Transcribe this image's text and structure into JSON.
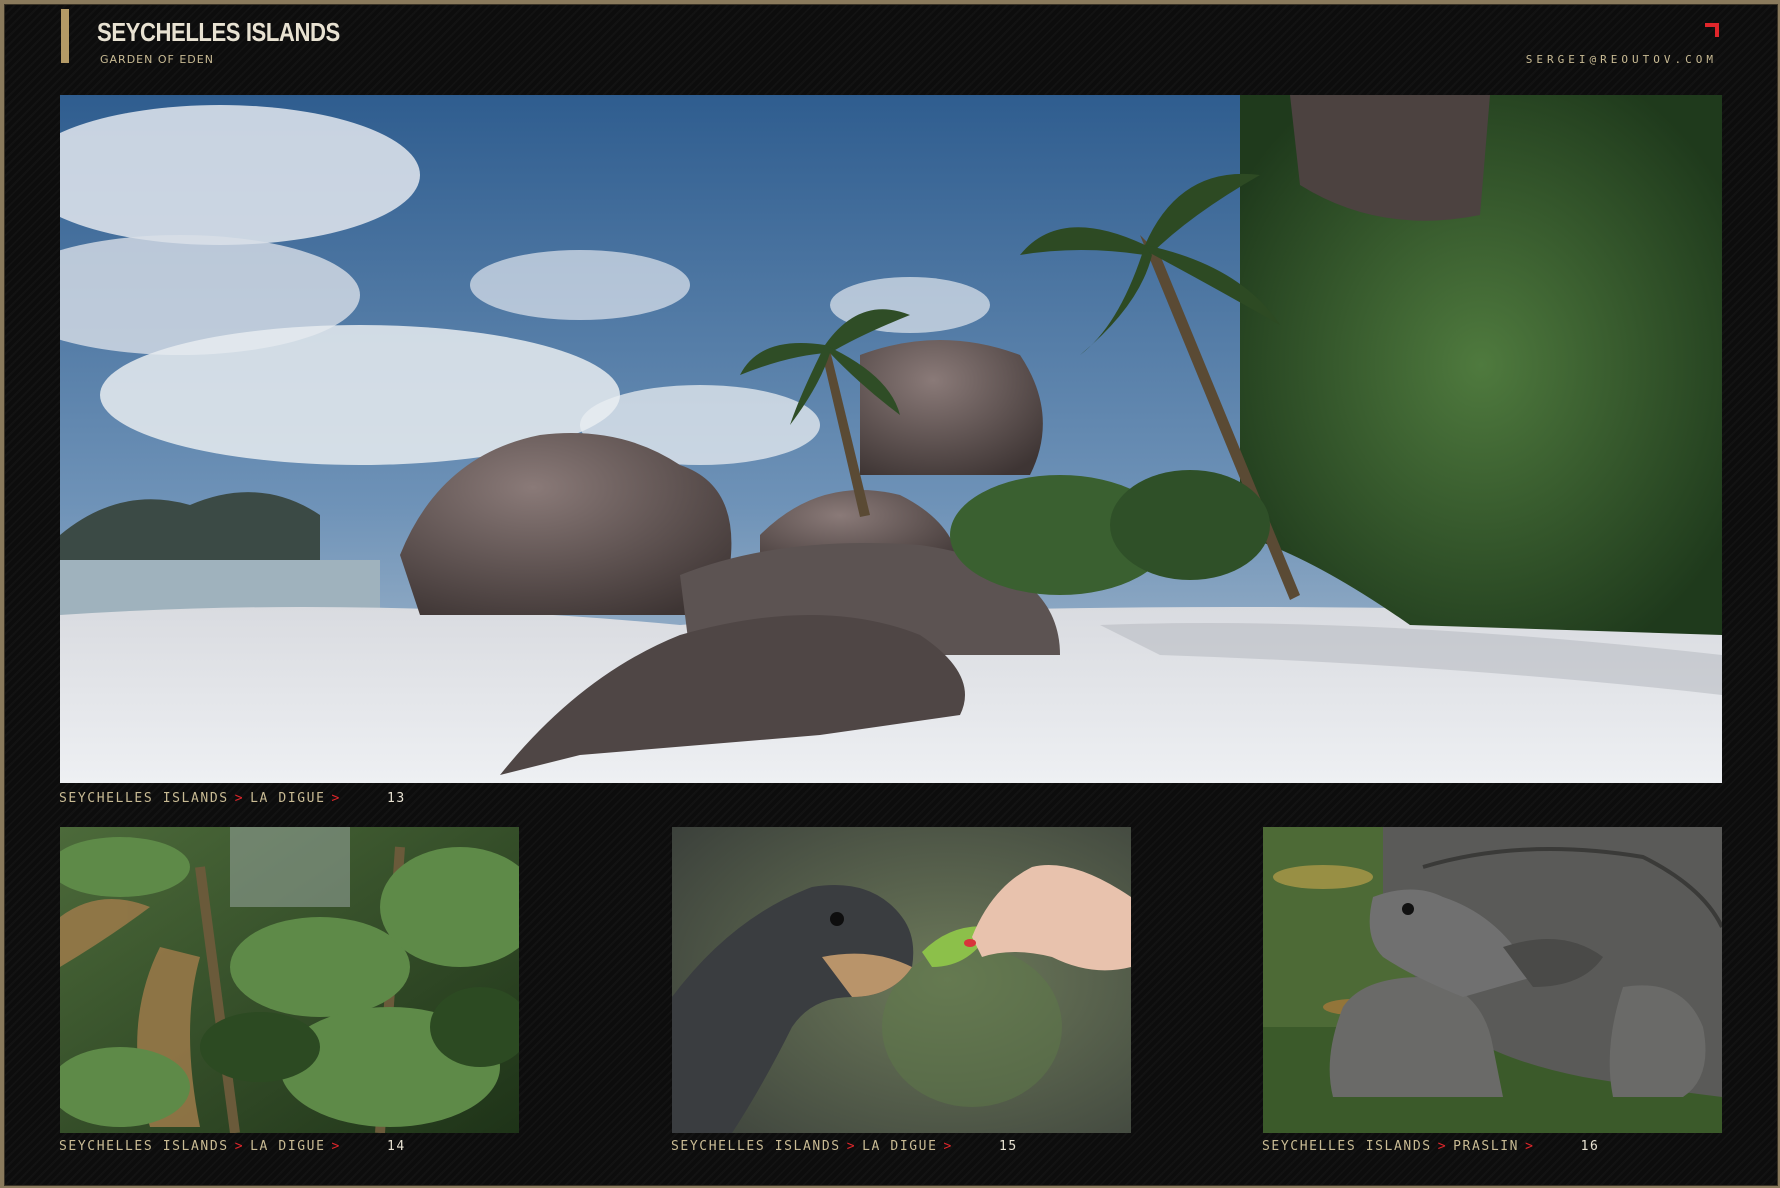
{
  "header": {
    "title": "SEYCHELLES ISLANDS",
    "subtitle": "GARDEN OF EDEN",
    "email": "SERGEI@REOUTOV.COM"
  },
  "colors": {
    "accent_gold": "#b49a66",
    "accent_red": "#e0262b",
    "background": "#0d0d0d",
    "text_light": "#e8e2d2",
    "text_gold": "#c9bb94"
  },
  "photos": [
    {
      "caption": {
        "location": "SEYCHELLES ISLANDS",
        "sublocation": "LA DIGUE",
        "sep": ">",
        "number": "13"
      }
    },
    {
      "caption": {
        "location": "SEYCHELLES ISLANDS",
        "sublocation": "LA DIGUE",
        "sep": ">",
        "number": "14"
      }
    },
    {
      "caption": {
        "location": "SEYCHELLES ISLANDS",
        "sublocation": "LA DIGUE",
        "sep": ">",
        "number": "15"
      }
    },
    {
      "caption": {
        "location": "SEYCHELLES ISLANDS",
        "sublocation": "PRASLIN",
        "sep": ">",
        "number": "16"
      }
    }
  ]
}
